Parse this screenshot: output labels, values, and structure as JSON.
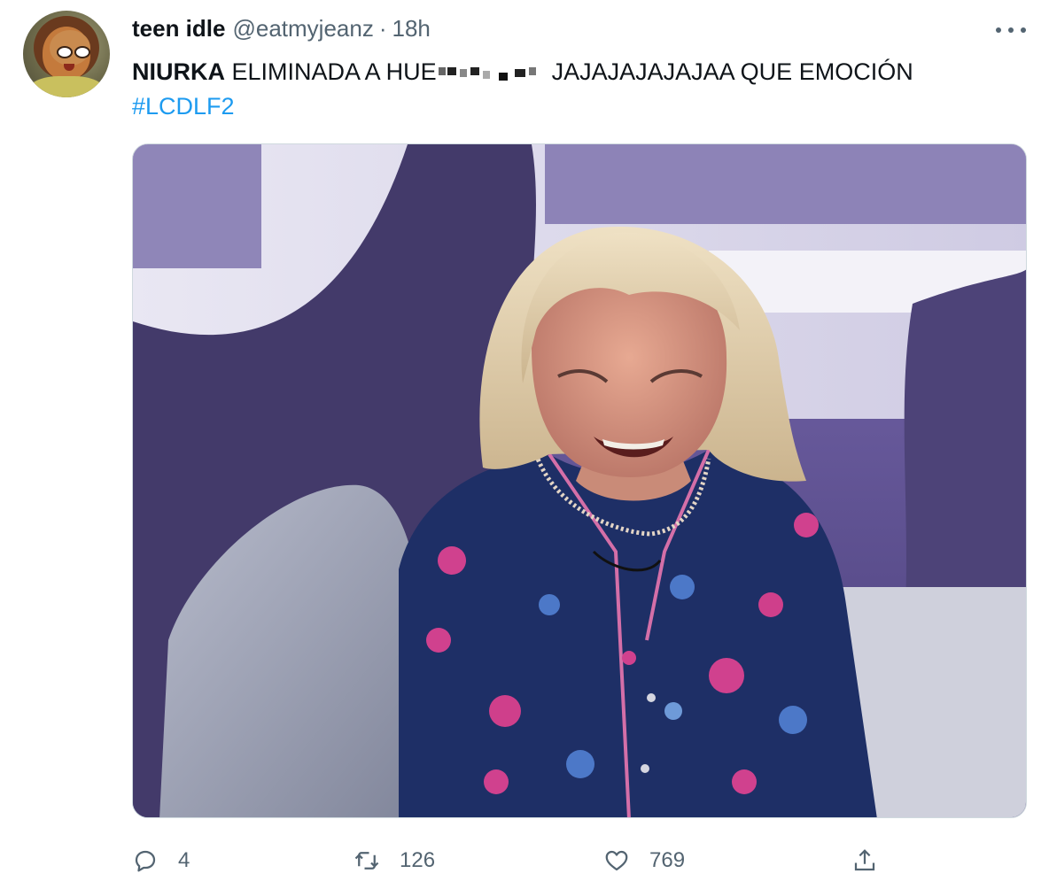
{
  "tweet": {
    "author_name": "teen idle",
    "author_handle": "@eatmyjeanz",
    "separator": "·",
    "time": "18h",
    "text_bold": "NIURKA",
    "text_part1": "ELIMINADA A HUE",
    "text_part2": "JAJAJAJAJAJAA QUE EMOCIÓN",
    "hashtag": "#LCDLF2"
  },
  "actions": {
    "reply_count": "4",
    "retweet_count": "126",
    "like_count": "769"
  },
  "icons": {
    "more": "more-horizontal-icon",
    "reply": "reply-icon",
    "retweet": "retweet-icon",
    "like": "heart-icon",
    "share": "share-icon"
  },
  "colors": {
    "text": "#0f1419",
    "secondary": "#536471",
    "link": "#1d9bf0"
  }
}
